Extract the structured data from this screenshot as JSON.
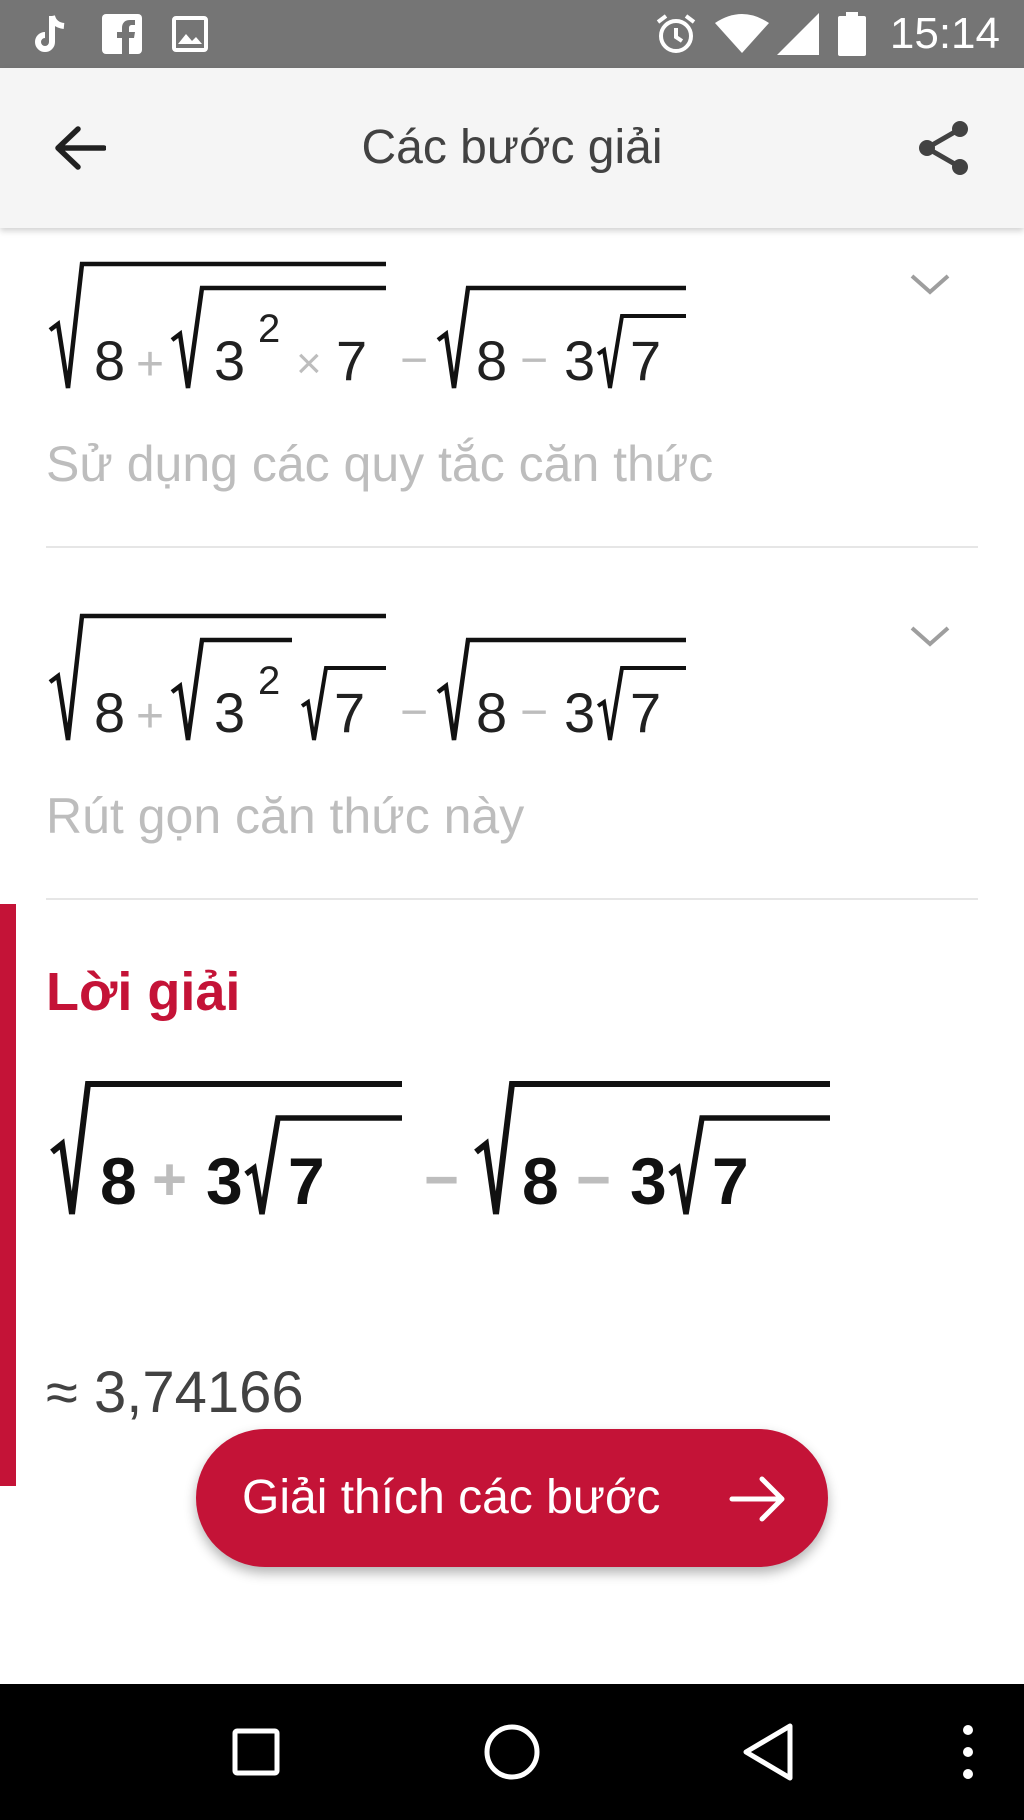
{
  "status_bar": {
    "time": "15:14",
    "left_icons": [
      "tiktok-icon",
      "facebook-icon",
      "image-icon"
    ],
    "right_icons": [
      "alarm-icon",
      "wifi-icon",
      "signal-icon",
      "battery-icon"
    ]
  },
  "app_bar": {
    "title": "Các bước giải",
    "back_icon": "arrow-left-icon",
    "share_icon": "share-icon"
  },
  "steps": [
    {
      "expression": {
        "outer1": [
          "8",
          "+",
          "3",
          "2",
          "×",
          "7"
        ],
        "minus": "−",
        "outer2": [
          "8",
          "−",
          "3",
          "7"
        ]
      },
      "description": "Sử dụng các quy tắc căn thức",
      "chevron_icon": "chevron-down-icon"
    },
    {
      "expression": {
        "outer1": [
          "8",
          "+",
          "3",
          "2",
          "7"
        ],
        "minus": "−",
        "outer2": [
          "8",
          "−",
          "3",
          "7"
        ]
      },
      "description": "Rút gọn căn thức này",
      "chevron_icon": "chevron-down-icon"
    }
  ],
  "solution": {
    "title": "Lời giải",
    "expression": {
      "outer1": [
        "8",
        "+",
        "3",
        "7"
      ],
      "minus": "−",
      "outer2": [
        "8",
        "−",
        "3",
        "7"
      ]
    },
    "approx": "≈ 3,74166",
    "accent_color": "#c41337"
  },
  "explain_button": {
    "label": "Giải thích các bước",
    "icon": "arrow-right-icon"
  },
  "nav_bar": {
    "buttons": [
      "recents-icon",
      "home-icon",
      "back-triangle-icon",
      "more-vert-icon"
    ]
  }
}
